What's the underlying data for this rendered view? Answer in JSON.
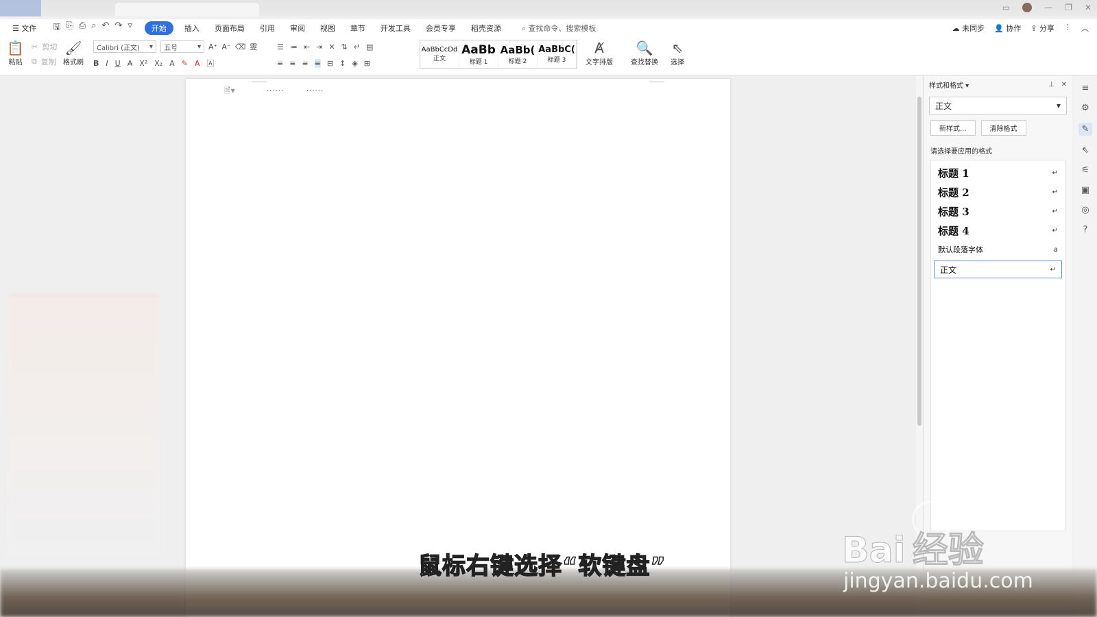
{
  "menubar": {
    "file": "文件",
    "tabs": [
      "开始",
      "插入",
      "页面布局",
      "引用",
      "审阅",
      "视图",
      "章节",
      "开发工具",
      "会员专享",
      "稻壳资源"
    ],
    "active_tab": "开始",
    "search_placeholder": "查找命令、搜索模板",
    "right": {
      "sync": "未同步",
      "collab": "协作",
      "share": "分享"
    }
  },
  "ribbon": {
    "paste": "粘贴",
    "cut": "剪切",
    "copy": "复制",
    "format_painter": "格式刷",
    "font_name": "Calibri (正文)",
    "font_size": "五号",
    "styles": [
      {
        "preview": "AaBbCcDd",
        "caption": "正文"
      },
      {
        "preview": "AaBb",
        "caption": "标题 1"
      },
      {
        "preview": "AaBb(",
        "caption": "标题 2"
      },
      {
        "preview": "AaBbC(",
        "caption": "标题 3"
      }
    ],
    "text_layout": "文字排版",
    "find_replace": "查找替换",
    "select": "选择"
  },
  "document": {
    "dots_1": "......",
    "dots_2": "......"
  },
  "styles_panel": {
    "title": "样式和格式",
    "current_style": "正文",
    "new_style": "新样式...",
    "clear_format": "清除格式",
    "apply_label": "请选择要应用的格式",
    "items": [
      {
        "name": "标题  1",
        "mark": "↵"
      },
      {
        "name": "标题  2",
        "mark": "↵"
      },
      {
        "name": "标题  3",
        "mark": "↵"
      },
      {
        "name": "标题  4",
        "mark": "↵"
      },
      {
        "name": "默认段落字体",
        "mark": "a"
      },
      {
        "name": "正文",
        "mark": "↵"
      }
    ]
  },
  "subtitle": "鼠标右键选择“软键盘”",
  "watermark": {
    "brand": "Bai 经验",
    "url": "jingyan.baidu.com"
  },
  "colors": {
    "accent": "#2f6fe0",
    "selected_border": "#6a8fd8"
  }
}
